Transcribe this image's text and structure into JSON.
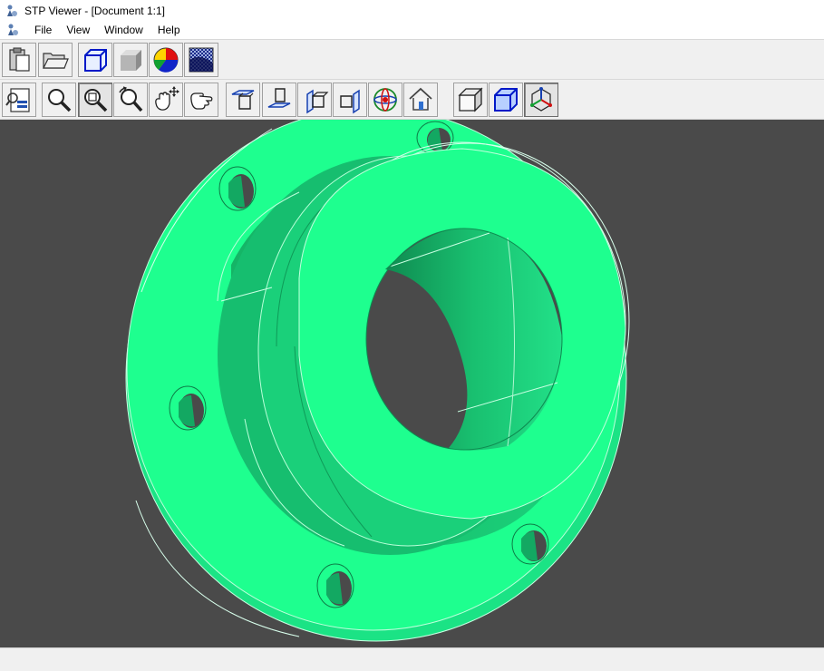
{
  "window": {
    "title": "STP Viewer - [Document 1:1]"
  },
  "menu": {
    "items": [
      "File",
      "View",
      "Window",
      "Help"
    ]
  },
  "toolbar1": [
    {
      "name": "paste-button",
      "icon": "clipboard-icon"
    },
    {
      "name": "open-button",
      "icon": "folder-open-icon"
    },
    {
      "name": "wireframe-button",
      "icon": "wireframe-cube-icon"
    },
    {
      "name": "shaded-button",
      "icon": "shaded-cube-icon"
    },
    {
      "name": "color-button",
      "icon": "color-wheel-icon"
    },
    {
      "name": "background-button",
      "icon": "background-gradient-icon"
    }
  ],
  "toolbar2": [
    {
      "name": "print-preview-button",
      "icon": "print-preview-icon"
    },
    {
      "name": "zoom-button",
      "icon": "magnifier-icon"
    },
    {
      "name": "zoom-window-button",
      "icon": "zoom-window-icon",
      "pressed": true
    },
    {
      "name": "zoom-dynamic-button",
      "icon": "zoom-rotate-icon"
    },
    {
      "name": "pan-button",
      "icon": "hand-move-icon"
    },
    {
      "name": "rotate-button",
      "icon": "hand-rotate-icon"
    },
    {
      "name": "view-top-button",
      "icon": "view-top-icon"
    },
    {
      "name": "view-bottom-button",
      "icon": "view-bottom-icon"
    },
    {
      "name": "view-left-button",
      "icon": "view-left-icon"
    },
    {
      "name": "view-right-button",
      "icon": "view-right-icon"
    },
    {
      "name": "view-axo-button",
      "icon": "globe-axis-icon"
    },
    {
      "name": "view-home-button",
      "icon": "home-icon"
    },
    {
      "name": "shaded-display-button",
      "icon": "solid-box-icon"
    },
    {
      "name": "wire-display-button",
      "icon": "blue-box-icon"
    },
    {
      "name": "axis-display-button",
      "icon": "axis-triad-icon",
      "pressed": true
    }
  ],
  "colors": {
    "model": "#1eff8f",
    "model_shade": "#18c873",
    "model_dark": "#0f9c5a",
    "viewport_bg": "#4a4a4a"
  },
  "status": {
    "text": ""
  }
}
